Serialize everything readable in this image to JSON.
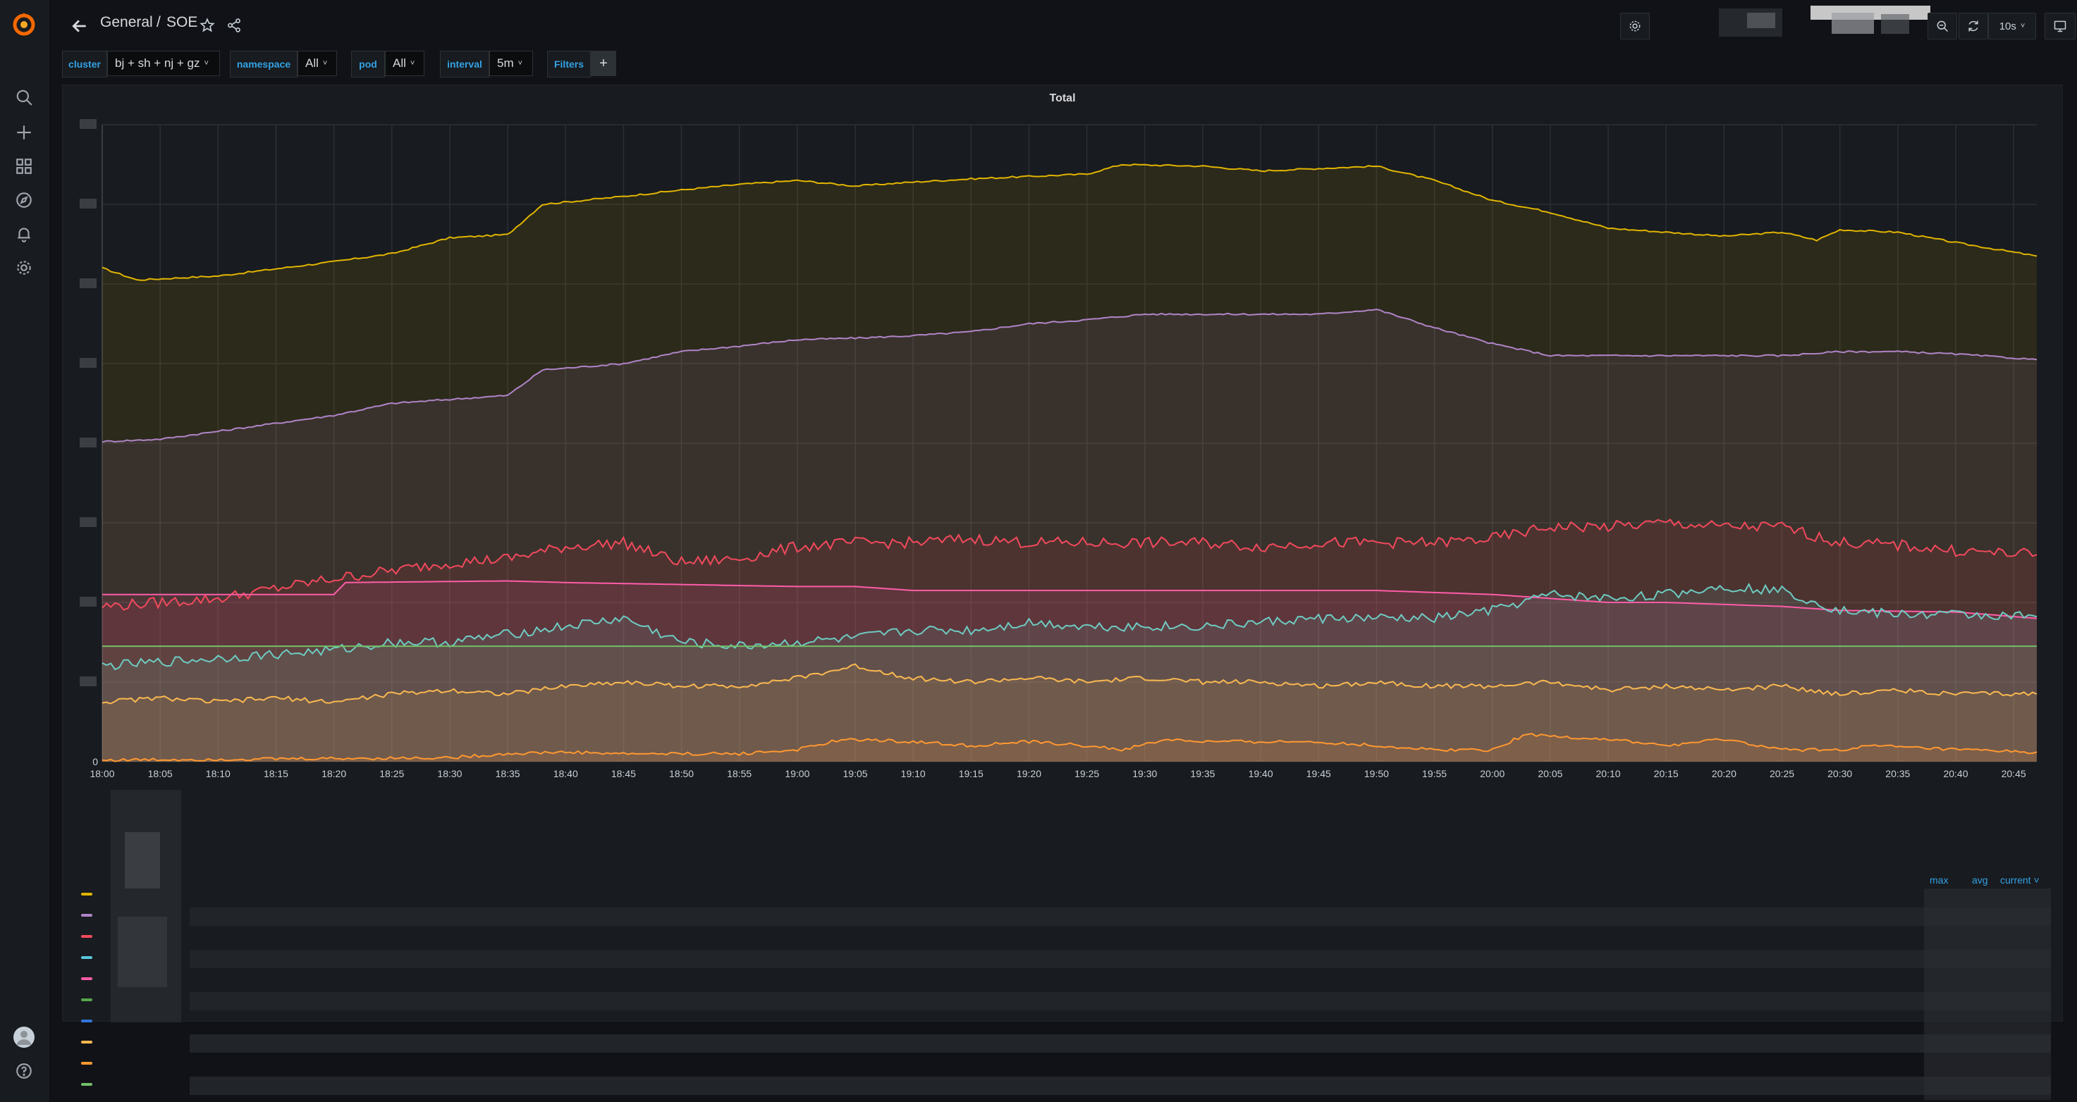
{
  "header": {
    "folder": "General",
    "separator": "/",
    "dashboard": "SOE",
    "refresh_interval": "10s"
  },
  "variables": [
    {
      "label": "cluster",
      "value": "bj + sh + nj + gz",
      "has_caret": true
    },
    {
      "label": "namespace",
      "value": "All",
      "has_caret": true
    },
    {
      "label": "pod",
      "value": "All",
      "has_caret": true
    },
    {
      "label": "interval",
      "value": "5m",
      "has_caret": true
    },
    {
      "label": "Filters",
      "value": "+",
      "has_caret": false
    }
  ],
  "panel": {
    "title": "Total",
    "legend_columns": [
      "max",
      "avg",
      "current"
    ],
    "legend_sort_indicator": "˅"
  },
  "colors": {
    "bg": "#111217",
    "panel": "#181b1f",
    "accent": "#33a2e5"
  },
  "chart_data": {
    "type": "area",
    "title": "Total",
    "x_ticks": [
      "18:00",
      "18:05",
      "18:10",
      "18:15",
      "18:20",
      "18:25",
      "18:30",
      "18:35",
      "18:40",
      "18:45",
      "18:50",
      "18:55",
      "19:00",
      "19:05",
      "19:10",
      "19:15",
      "19:20",
      "19:25",
      "19:30",
      "19:35",
      "19:40",
      "19:45",
      "19:50",
      "19:55",
      "20:00",
      "20:05",
      "20:10",
      "20:15",
      "20:20",
      "20:25",
      "20:30",
      "20:35",
      "20:40",
      "20:45"
    ],
    "y_tick_labels_visible": [
      "0"
    ],
    "x_start": "18:00",
    "x_end": "20:47",
    "series_relative_scale": "0-8 grid units",
    "series": [
      {
        "color": "#e0b400",
        "points": [
          [
            "18:00",
            6.2
          ],
          [
            "18:03",
            6.05
          ],
          [
            "18:10",
            6.1
          ],
          [
            "18:20",
            6.28
          ],
          [
            "18:25",
            6.38
          ],
          [
            "18:30",
            6.58
          ],
          [
            "18:35",
            6.62
          ],
          [
            "18:38",
            7.0
          ],
          [
            "18:45",
            7.1
          ],
          [
            "18:50",
            7.18
          ],
          [
            "18:55",
            7.25
          ],
          [
            "19:00",
            7.3
          ],
          [
            "19:05",
            7.23
          ],
          [
            "19:10",
            7.28
          ],
          [
            "19:15",
            7.32
          ],
          [
            "19:20",
            7.35
          ],
          [
            "19:25",
            7.38
          ],
          [
            "19:28",
            7.5
          ],
          [
            "19:35",
            7.48
          ],
          [
            "19:40",
            7.42
          ],
          [
            "19:45",
            7.45
          ],
          [
            "19:50",
            7.48
          ],
          [
            "19:55",
            7.3
          ],
          [
            "20:00",
            7.05
          ],
          [
            "20:05",
            6.9
          ],
          [
            "20:10",
            6.7
          ],
          [
            "20:15",
            6.65
          ],
          [
            "20:20",
            6.6
          ],
          [
            "20:25",
            6.65
          ],
          [
            "20:28",
            6.55
          ],
          [
            "20:30",
            6.68
          ],
          [
            "20:35",
            6.65
          ],
          [
            "20:40",
            6.52
          ],
          [
            "20:47",
            6.35
          ]
        ]
      },
      {
        "color": "#b084c8",
        "points": [
          [
            "18:00",
            4.02
          ],
          [
            "18:05",
            4.05
          ],
          [
            "18:10",
            4.15
          ],
          [
            "18:20",
            4.35
          ],
          [
            "18:25",
            4.5
          ],
          [
            "18:30",
            4.55
          ],
          [
            "18:35",
            4.6
          ],
          [
            "18:38",
            4.92
          ],
          [
            "18:45",
            5.0
          ],
          [
            "18:50",
            5.15
          ],
          [
            "18:55",
            5.22
          ],
          [
            "19:00",
            5.3
          ],
          [
            "19:05",
            5.32
          ],
          [
            "19:10",
            5.35
          ],
          [
            "19:15",
            5.4
          ],
          [
            "19:20",
            5.5
          ],
          [
            "19:25",
            5.55
          ],
          [
            "19:30",
            5.62
          ],
          [
            "19:35",
            5.62
          ],
          [
            "19:40",
            5.62
          ],
          [
            "19:45",
            5.62
          ],
          [
            "19:50",
            5.68
          ],
          [
            "19:55",
            5.45
          ],
          [
            "20:00",
            5.25
          ],
          [
            "20:05",
            5.1
          ],
          [
            "20:10",
            5.1
          ],
          [
            "20:15",
            5.1
          ],
          [
            "20:20",
            5.1
          ],
          [
            "20:25",
            5.1
          ],
          [
            "20:30",
            5.15
          ],
          [
            "20:35",
            5.15
          ],
          [
            "20:40",
            5.12
          ],
          [
            "20:47",
            5.05
          ]
        ]
      },
      {
        "color": "#f2495c",
        "points": [
          [
            "18:00",
            1.95
          ],
          [
            "18:10",
            2.05
          ],
          [
            "18:20",
            2.3
          ],
          [
            "18:25",
            2.4
          ],
          [
            "18:30",
            2.5
          ],
          [
            "18:35",
            2.55
          ],
          [
            "18:40",
            2.7
          ],
          [
            "18:45",
            2.75
          ],
          [
            "18:50",
            2.5
          ],
          [
            "18:55",
            2.55
          ],
          [
            "19:00",
            2.7
          ],
          [
            "19:05",
            2.75
          ],
          [
            "19:10",
            2.75
          ],
          [
            "19:15",
            2.8
          ],
          [
            "19:20",
            2.75
          ],
          [
            "19:25",
            2.75
          ],
          [
            "19:30",
            2.75
          ],
          [
            "19:35",
            2.75
          ],
          [
            "19:40",
            2.7
          ],
          [
            "19:45",
            2.75
          ],
          [
            "19:50",
            2.75
          ],
          [
            "19:55",
            2.75
          ],
          [
            "20:00",
            2.8
          ],
          [
            "20:05",
            2.95
          ],
          [
            "20:10",
            2.95
          ],
          [
            "20:15",
            3.0
          ],
          [
            "20:20",
            2.95
          ],
          [
            "20:25",
            2.95
          ],
          [
            "20:30",
            2.75
          ],
          [
            "20:35",
            2.72
          ],
          [
            "20:40",
            2.65
          ],
          [
            "20:47",
            2.6
          ]
        ]
      },
      {
        "color": "#ff5ca8",
        "points": [
          [
            "18:00",
            2.1
          ],
          [
            "18:20",
            2.1
          ],
          [
            "18:21",
            2.25
          ],
          [
            "18:35",
            2.27
          ],
          [
            "18:40",
            2.25
          ],
          [
            "19:00",
            2.2
          ],
          [
            "19:05",
            2.2
          ],
          [
            "19:10",
            2.15
          ],
          [
            "19:30",
            2.15
          ],
          [
            "19:50",
            2.15
          ],
          [
            "20:00",
            2.1
          ],
          [
            "20:05",
            2.05
          ],
          [
            "20:10",
            2.0
          ],
          [
            "20:15",
            2.0
          ],
          [
            "20:25",
            1.95
          ],
          [
            "20:30",
            1.9
          ],
          [
            "20:40",
            1.88
          ],
          [
            "20:47",
            1.8
          ]
        ]
      },
      {
        "color": "#6ecbc2",
        "points": [
          [
            "18:00",
            1.2
          ],
          [
            "18:10",
            1.3
          ],
          [
            "18:20",
            1.4
          ],
          [
            "18:25",
            1.5
          ],
          [
            "18:30",
            1.5
          ],
          [
            "18:35",
            1.6
          ],
          [
            "18:40",
            1.7
          ],
          [
            "18:45",
            1.8
          ],
          [
            "18:50",
            1.5
          ],
          [
            "18:55",
            1.45
          ],
          [
            "19:00",
            1.5
          ],
          [
            "19:05",
            1.55
          ],
          [
            "19:10",
            1.65
          ],
          [
            "19:15",
            1.65
          ],
          [
            "19:20",
            1.75
          ],
          [
            "19:25",
            1.7
          ],
          [
            "19:30",
            1.7
          ],
          [
            "19:35",
            1.7
          ],
          [
            "19:40",
            1.75
          ],
          [
            "19:45",
            1.8
          ],
          [
            "19:50",
            1.8
          ],
          [
            "19:55",
            1.8
          ],
          [
            "20:00",
            1.9
          ],
          [
            "20:05",
            2.1
          ],
          [
            "20:10",
            2.05
          ],
          [
            "20:15",
            2.1
          ],
          [
            "20:20",
            2.2
          ],
          [
            "20:25",
            2.15
          ],
          [
            "20:30",
            1.9
          ],
          [
            "20:35",
            1.85
          ],
          [
            "20:40",
            1.85
          ],
          [
            "20:47",
            1.82
          ]
        ]
      },
      {
        "color": "#73bf69",
        "points": [
          [
            "18:00",
            1.45
          ],
          [
            "20:47",
            1.45
          ]
        ]
      },
      {
        "color": "#fab84f",
        "points": [
          [
            "18:00",
            0.75
          ],
          [
            "18:05",
            0.8
          ],
          [
            "18:10",
            0.75
          ],
          [
            "18:15",
            0.8
          ],
          [
            "18:20",
            0.75
          ],
          [
            "18:25",
            0.85
          ],
          [
            "18:30",
            0.9
          ],
          [
            "18:35",
            0.85
          ],
          [
            "18:40",
            0.95
          ],
          [
            "18:45",
            1.0
          ],
          [
            "18:50",
            0.95
          ],
          [
            "18:55",
            0.95
          ],
          [
            "19:00",
            1.05
          ],
          [
            "19:05",
            1.2
          ],
          [
            "19:10",
            1.05
          ],
          [
            "19:15",
            1.0
          ],
          [
            "19:20",
            1.05
          ],
          [
            "19:25",
            1.0
          ],
          [
            "19:30",
            1.05
          ],
          [
            "19:35",
            1.0
          ],
          [
            "19:40",
            1.0
          ],
          [
            "19:45",
            0.95
          ],
          [
            "19:50",
            1.0
          ],
          [
            "19:55",
            0.95
          ],
          [
            "20:00",
            0.95
          ],
          [
            "20:05",
            1.0
          ],
          [
            "20:10",
            0.9
          ],
          [
            "20:15",
            0.95
          ],
          [
            "20:20",
            0.9
          ],
          [
            "20:25",
            0.95
          ],
          [
            "20:30",
            0.85
          ],
          [
            "20:35",
            0.9
          ],
          [
            "20:40",
            0.85
          ],
          [
            "20:47",
            0.85
          ]
        ]
      },
      {
        "color": "#ff9830",
        "points": [
          [
            "18:00",
            0.02
          ],
          [
            "18:30",
            0.05
          ],
          [
            "18:35",
            0.1
          ],
          [
            "18:40",
            0.12
          ],
          [
            "18:45",
            0.1
          ],
          [
            "18:55",
            0.1
          ],
          [
            "19:00",
            0.15
          ],
          [
            "19:03",
            0.25
          ],
          [
            "19:05",
            0.28
          ],
          [
            "19:10",
            0.25
          ],
          [
            "19:15",
            0.2
          ],
          [
            "19:20",
            0.25
          ],
          [
            "19:25",
            0.2
          ],
          [
            "19:28",
            0.15
          ],
          [
            "19:32",
            0.28
          ],
          [
            "19:35",
            0.25
          ],
          [
            "19:45",
            0.25
          ],
          [
            "19:50",
            0.2
          ],
          [
            "19:55",
            0.15
          ],
          [
            "20:00",
            0.15
          ],
          [
            "20:03",
            0.35
          ],
          [
            "20:05",
            0.32
          ],
          [
            "20:10",
            0.28
          ],
          [
            "20:15",
            0.2
          ],
          [
            "20:20",
            0.28
          ],
          [
            "20:25",
            0.15
          ],
          [
            "20:30",
            0.15
          ],
          [
            "20:33",
            0.2
          ],
          [
            "20:40",
            0.15
          ],
          [
            "20:47",
            0.12
          ]
        ]
      }
    ]
  },
  "legend": {
    "rows": [
      {
        "color": "#e0b400"
      },
      {
        "color": "#b084c8"
      },
      {
        "color": "#f2495c"
      },
      {
        "color": "#5ac5dd"
      },
      {
        "color": "#ff5ca8"
      },
      {
        "color": "#56a64b"
      },
      {
        "color": "#3274d9"
      },
      {
        "color": "#fab84f"
      },
      {
        "color": "#ff9830"
      },
      {
        "color": "#73bf69"
      }
    ]
  }
}
